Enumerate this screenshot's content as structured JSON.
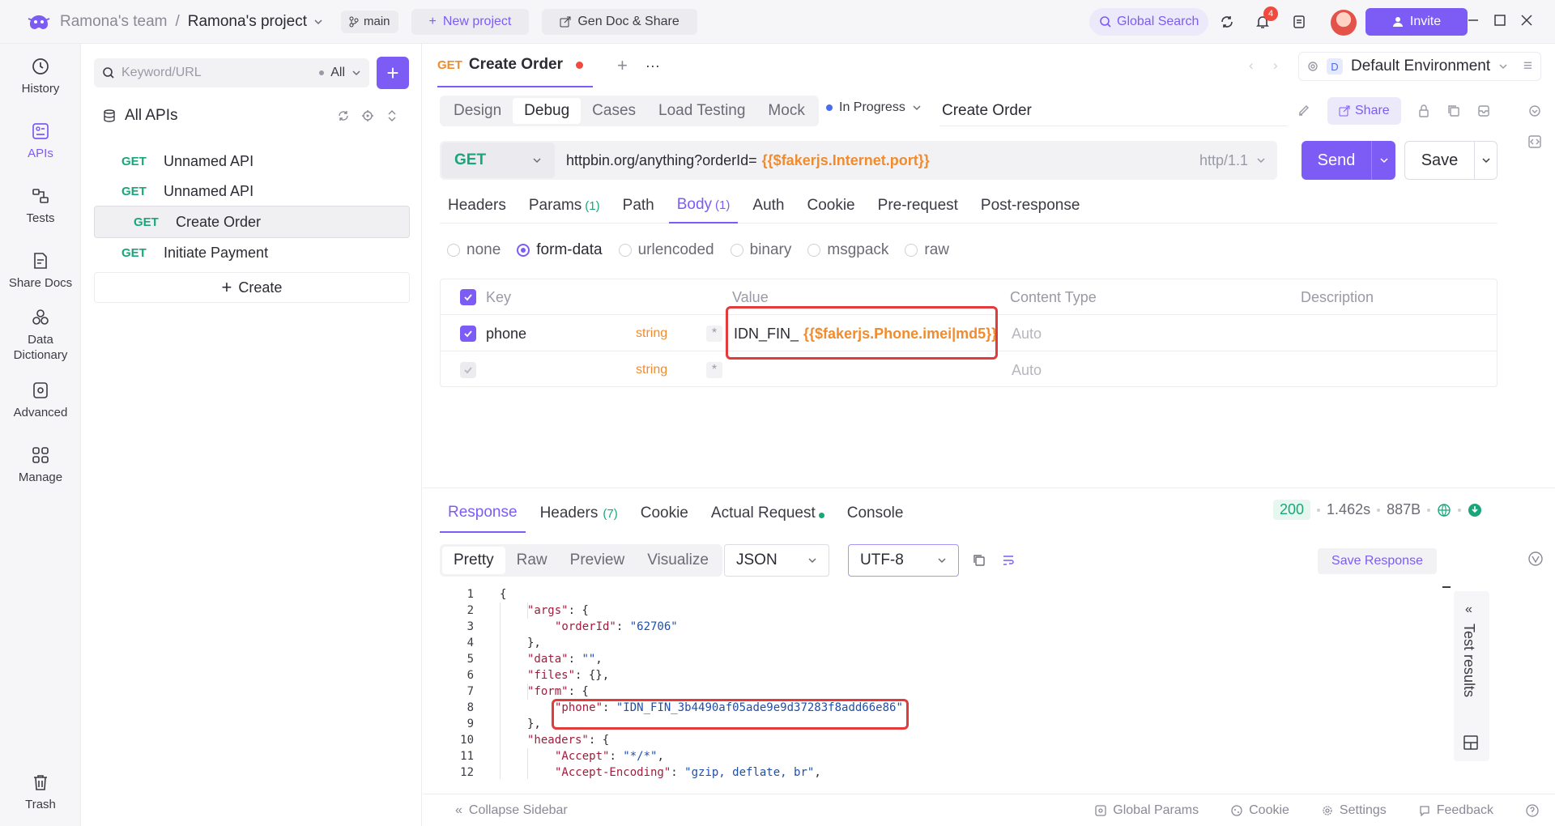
{
  "titlebar": {
    "team": "Ramona's team",
    "separator": "/",
    "project": "Ramona's project",
    "branch": "main",
    "new_project": "New project",
    "gen_doc": "Gen Doc & Share",
    "global_search": "Global Search",
    "notifications": "4",
    "invite": "Invite"
  },
  "nav": [
    {
      "label": "History",
      "icon": "history-icon"
    },
    {
      "label": "APIs",
      "icon": "apis-icon"
    },
    {
      "label": "Tests",
      "icon": "tests-icon"
    },
    {
      "label": "Share Docs",
      "icon": "share-docs-icon"
    },
    {
      "label": "Data Dictionary",
      "icon": "data-dictionary-icon"
    },
    {
      "label": "Advanced",
      "icon": "advanced-icon"
    },
    {
      "label": "Manage",
      "icon": "manage-icon"
    },
    {
      "label": "Trash",
      "icon": "trash-icon"
    }
  ],
  "sidebar": {
    "search_placeholder": "Keyword/URL",
    "filter": "All",
    "title": "All APIs",
    "apis": [
      {
        "method": "GET",
        "name": "Unnamed API"
      },
      {
        "method": "GET",
        "name": "Unnamed API"
      },
      {
        "method": "GET",
        "name": "Create Order"
      },
      {
        "method": "GET",
        "name": "Initiate Payment"
      }
    ],
    "create": "Create"
  },
  "tab": {
    "method": "GET",
    "title": "Create Order"
  },
  "environment": {
    "badge": "D",
    "name": "Default Environment"
  },
  "modes": [
    "Design",
    "Debug",
    "Cases",
    "Load Testing",
    "Mock"
  ],
  "status": "In Progress",
  "api_name": "Create Order",
  "share": "Share",
  "request": {
    "method": "GET",
    "url_base": "httpbin.org/anything?orderId=",
    "url_var": "{{$fakerjs.Internet.port}}",
    "protocol": "http/1.1",
    "send": "Send",
    "save": "Save"
  },
  "req_tabs": [
    {
      "label": "Headers",
      "count": ""
    },
    {
      "label": "Params",
      "count": "(1)"
    },
    {
      "label": "Path",
      "count": ""
    },
    {
      "label": "Body",
      "count": "(1)"
    },
    {
      "label": "Auth",
      "count": ""
    },
    {
      "label": "Cookie",
      "count": ""
    },
    {
      "label": "Pre-request",
      "count": ""
    },
    {
      "label": "Post-response",
      "count": ""
    }
  ],
  "body_types": [
    "none",
    "form-data",
    "urlencoded",
    "binary",
    "msgpack",
    "raw"
  ],
  "params_table": {
    "headers": {
      "key": "Key",
      "value": "Value",
      "content_type": "Content Type",
      "description": "Description"
    },
    "rows": [
      {
        "key": "phone",
        "type": "string",
        "required": "*",
        "value_prefix": "IDN_FIN_",
        "value_var": "{{$fakerjs.Phone.imei|md5}}",
        "content_type": "Auto"
      },
      {
        "key": "",
        "type": "string",
        "required": "*",
        "value_prefix": "",
        "value_var": "",
        "content_type": "Auto"
      }
    ]
  },
  "resp_tabs": [
    {
      "label": "Response",
      "count": ""
    },
    {
      "label": "Headers",
      "count": "(7)"
    },
    {
      "label": "Cookie",
      "count": ""
    },
    {
      "label": "Actual Request",
      "count": ""
    },
    {
      "label": "Console",
      "count": ""
    }
  ],
  "resp_meta": {
    "status": "200",
    "time": "1.462s",
    "size": "887B"
  },
  "views": [
    "Pretty",
    "Raw",
    "Preview",
    "Visualize"
  ],
  "format": "JSON",
  "encoding": "UTF-8",
  "save_response": "Save Response",
  "test_results": "Test results",
  "code_lines": [
    {
      "n": "1",
      "indent": 0,
      "text": "{"
    },
    {
      "n": "2",
      "indent": 1,
      "key": "\"args\"",
      "rest": ": {"
    },
    {
      "n": "3",
      "indent": 2,
      "key": "\"orderId\"",
      "sep": ": ",
      "val": "\"62706\""
    },
    {
      "n": "4",
      "indent": 1,
      "text": "},"
    },
    {
      "n": "5",
      "indent": 1,
      "key": "\"data\"",
      "sep": ": ",
      "val": "\"\"",
      "tail": ","
    },
    {
      "n": "6",
      "indent": 1,
      "key": "\"files\"",
      "rest": ": {},"
    },
    {
      "n": "7",
      "indent": 1,
      "key": "\"form\"",
      "rest": ": {"
    },
    {
      "n": "8",
      "indent": 2,
      "key": "\"phone\"",
      "sep": ": ",
      "val": "\"IDN_FIN_3b4490af05ade9e9d37283f8add66e86\""
    },
    {
      "n": "9",
      "indent": 1,
      "text": "},"
    },
    {
      "n": "10",
      "indent": 1,
      "key": "\"headers\"",
      "rest": ": {"
    },
    {
      "n": "11",
      "indent": 2,
      "key": "\"Accept\"",
      "sep": ": ",
      "val": "\"*/*\"",
      "tail": ","
    },
    {
      "n": "12",
      "indent": 2,
      "key": "\"Accept-Encoding\"",
      "sep": ": ",
      "val": "\"gzip, deflate, br\"",
      "tail": ","
    }
  ],
  "footer": {
    "collapse": "Collapse Sidebar",
    "global_params": "Global Params",
    "cookie": "Cookie",
    "settings": "Settings",
    "feedback": "Feedback"
  },
  "colors": {
    "accent": "#7c5cf5",
    "get": "#1aa67a",
    "variable": "#f08c2e",
    "highlight": "#e23b3b"
  }
}
